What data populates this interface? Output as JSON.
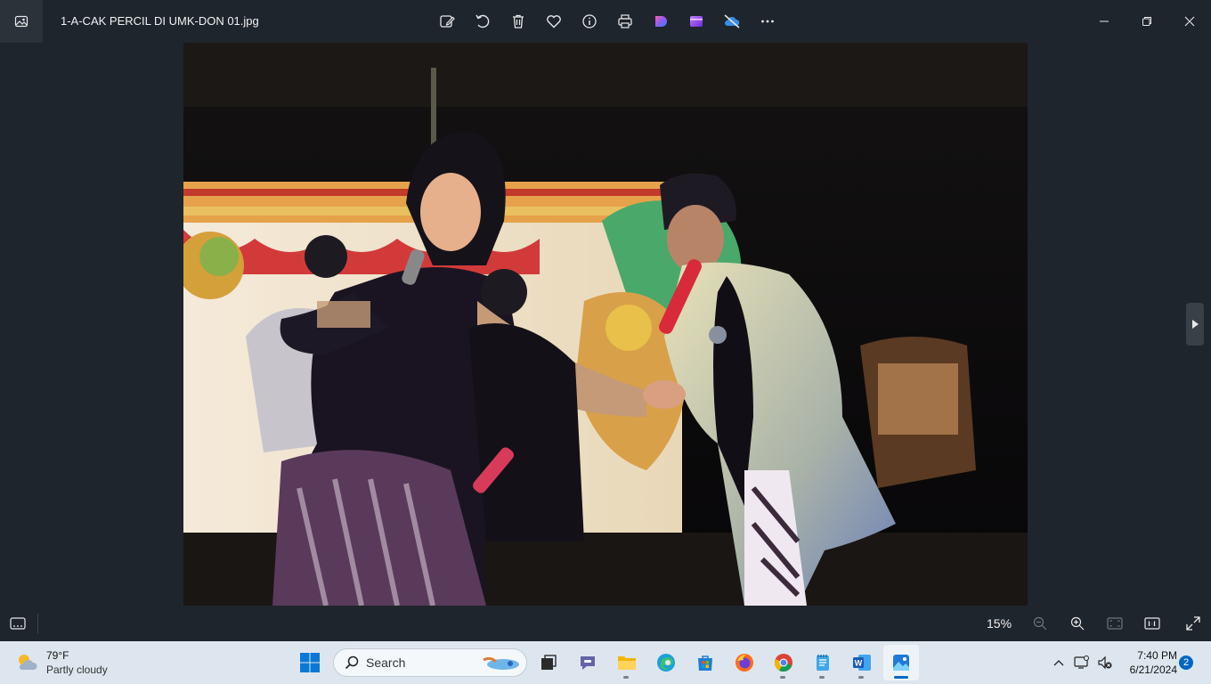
{
  "window": {
    "title": "1-A-CAK PERCIL DI UMK-DON 01.jpg",
    "app_icon": "photos-app-icon",
    "toolbar": [
      {
        "name": "edit-image-button",
        "icon": "edit-image-icon"
      },
      {
        "name": "rotate-button",
        "icon": "rotate-icon"
      },
      {
        "name": "delete-button",
        "icon": "trash-icon"
      },
      {
        "name": "favorite-button",
        "icon": "heart-icon"
      },
      {
        "name": "file-info-button",
        "icon": "info-icon"
      },
      {
        "name": "print-button",
        "icon": "printer-icon"
      },
      {
        "name": "designer-button",
        "icon": "designer-icon"
      },
      {
        "name": "clipchamp-button",
        "icon": "clipchamp-icon"
      },
      {
        "name": "onedrive-button",
        "icon": "cloud-off-icon"
      },
      {
        "name": "more-button",
        "icon": "ellipsis-icon"
      }
    ],
    "controls": [
      "minimize",
      "restore",
      "close"
    ]
  },
  "viewer": {
    "zoom": "15%",
    "image_description_icon": "photo"
  },
  "taskbar": {
    "weather": {
      "temp": "79°F",
      "condition": "Partly cloudy"
    },
    "search_placeholder": "Search",
    "apps": [
      "task-view",
      "teams-chat",
      "file-explorer",
      "edge",
      "microsoft-store",
      "firefox",
      "chrome",
      "notepad",
      "word",
      "photos"
    ],
    "clock": {
      "time": "7:40 PM",
      "date": "6/21/2024"
    },
    "notification_count": "2"
  },
  "colors": {
    "titlebar_bg": "#1f252c",
    "taskbar_bg": "#dde6ef",
    "accent": "#0067c0"
  }
}
